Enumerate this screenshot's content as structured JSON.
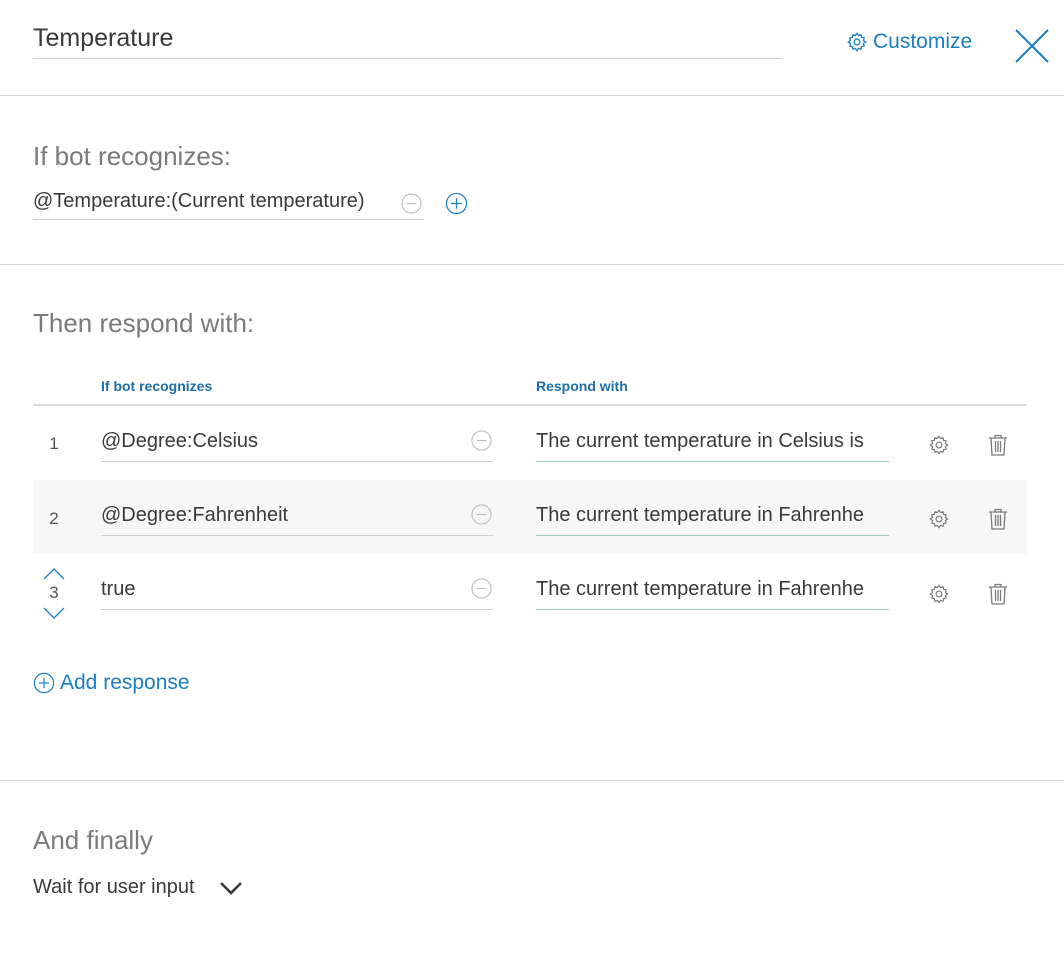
{
  "header": {
    "node_name": "Temperature",
    "customize_label": "Customize"
  },
  "condition": {
    "title": "If bot recognizes:",
    "value": "@Temperature:(Current temperature)"
  },
  "responses": {
    "title": "Then respond with:",
    "columns": {
      "condition": "If bot recognizes",
      "response": "Respond with"
    },
    "rows": [
      {
        "num": "1",
        "condition": "@Degree:Celsius",
        "response": "The current temperature in Celsius is"
      },
      {
        "num": "2",
        "condition": "@Degree:Fahrenheit",
        "response": "The current temperature in Fahrenhe"
      },
      {
        "num": "3",
        "condition": "true",
        "response": "The current temperature in Fahrenhe"
      }
    ],
    "add_label": "Add response"
  },
  "finally": {
    "title": "And finally",
    "selected": "Wait for user input"
  },
  "colors": {
    "accent": "#1b7ec2",
    "column_header": "#1f6ea6",
    "divider": "#d8d8d8",
    "alt_row": "#f7f7f7"
  }
}
